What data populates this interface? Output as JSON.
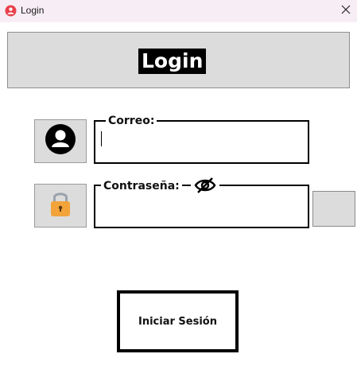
{
  "window": {
    "title": "Login",
    "icon": "app-logo-icon",
    "close_icon": "close-icon"
  },
  "header": {
    "title": "Login"
  },
  "form": {
    "email": {
      "label": "Correo:",
      "value": "",
      "icon": "user-icon"
    },
    "password": {
      "label": "Contraseña:",
      "value": "",
      "icon": "lock-icon",
      "toggle_icon": "eye-slash-icon"
    },
    "submit_label": "Iniciar Sesión"
  },
  "colors": {
    "panel": "#dcdcdc",
    "titlebar": "#f7eef5",
    "logo": "#e8424c",
    "lock_body": "#f2a33a"
  }
}
